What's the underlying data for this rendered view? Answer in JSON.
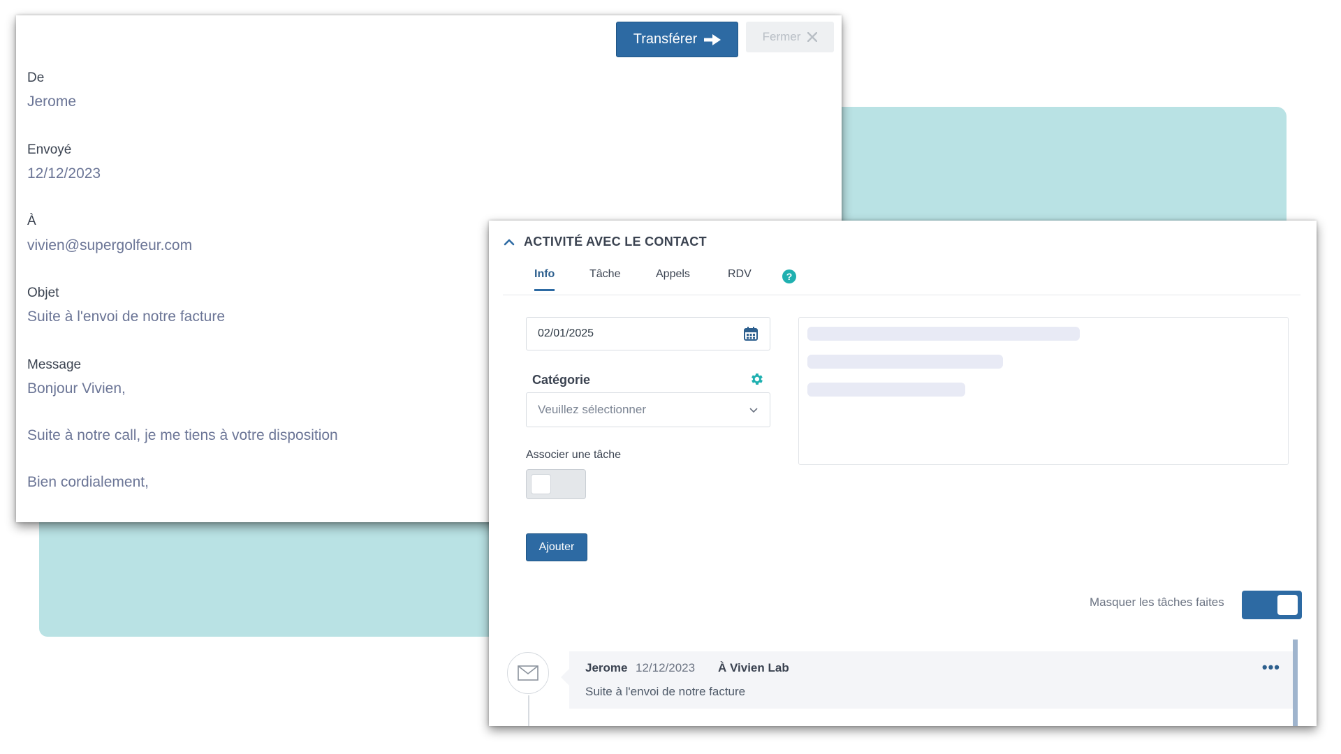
{
  "email": {
    "transfer_label": "Transférer",
    "close_label": "Fermer",
    "from_label": "De",
    "from_value": "Jerome",
    "sent_label": "Envoyé",
    "sent_value": "12/12/2023",
    "to_label": "À",
    "to_value": "vivien@supergolfeur.com",
    "subject_label": "Objet",
    "subject_value": "Suite à l'envoi de notre facture",
    "message_label": "Message",
    "message_lines": [
      "Bonjour Vivien,",
      "Suite à notre call, je me tiens à votre disposition",
      "Bien cordialement,"
    ]
  },
  "activity": {
    "title": "ACTIVITÉ AVEC LE CONTACT",
    "tabs": [
      {
        "label": "Info",
        "active": true
      },
      {
        "label": "Tâche",
        "active": false
      },
      {
        "label": "Appels",
        "active": false
      },
      {
        "label": "RDV",
        "active": false
      }
    ],
    "help_glyph": "?",
    "date_value": "02/01/2025",
    "category_label": "Catégorie",
    "category_placeholder": "Veuillez sélectionner",
    "associate_task_label": "Associer une tâche",
    "associate_task_on": false,
    "add_label": "Ajouter",
    "hide_done_label": "Masquer les tâches faites",
    "hide_done_on": true,
    "entry": {
      "author": "Jerome",
      "date": "12/12/2023",
      "recipient": "À Vivien Lab",
      "subject": "Suite à l'envoi de notre facture",
      "menu_glyph": "•••"
    }
  },
  "colors": {
    "primary": "#2d6aa3",
    "teal": "#b9e2e4",
    "accent_icon": "#1fb0b0"
  }
}
